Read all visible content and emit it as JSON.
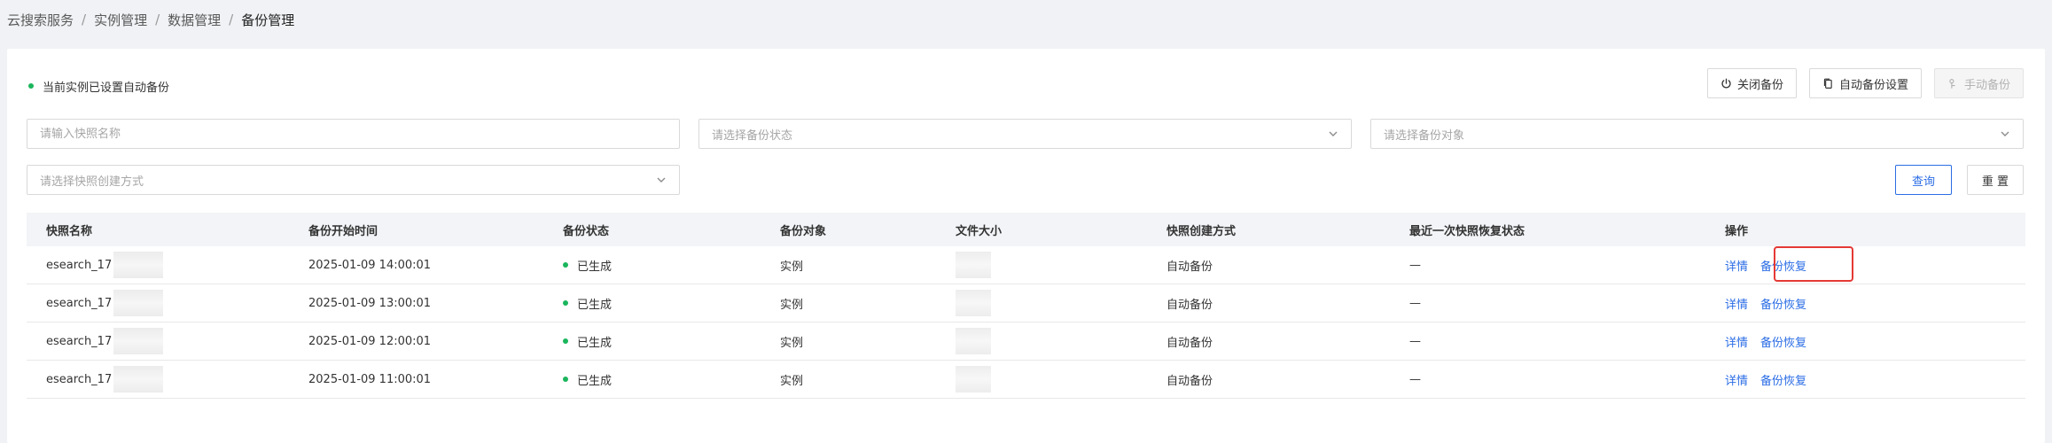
{
  "breadcrumb": [
    "云搜索服务",
    "实例管理",
    "数据管理",
    "备份管理"
  ],
  "status": {
    "text": "当前实例已设置自动备份",
    "color": "#1bb55c"
  },
  "toolbar": {
    "close_backup": "关闭备份",
    "auto_backup_settings": "自动备份设置",
    "manual_backup": "手动备份"
  },
  "filters": {
    "snapshot_name_placeholder": "请输入快照名称",
    "backup_status_placeholder": "请选择备份状态",
    "backup_object_placeholder": "请选择备份对象",
    "creation_method_placeholder": "请选择快照创建方式",
    "query": "查询",
    "reset": "重 置"
  },
  "table": {
    "headers": [
      "快照名称",
      "备份开始时间",
      "备份状态",
      "备份对象",
      "文件大小",
      "快照创建方式",
      "最近一次快照恢复状态",
      "操作"
    ],
    "rows": [
      {
        "name": "esearch_17",
        "start": "2025-01-09 14:00:01",
        "status": "已生成",
        "object": "实例",
        "method": "自动备份",
        "restore_status": "—",
        "detail": "详情",
        "restore": "备份恢复"
      },
      {
        "name": "esearch_17",
        "start": "2025-01-09 13:00:01",
        "status": "已生成",
        "object": "实例",
        "method": "自动备份",
        "restore_status": "—",
        "detail": "详情",
        "restore": "备份恢复"
      },
      {
        "name": "esearch_17",
        "start": "2025-01-09 12:00:01",
        "status": "已生成",
        "object": "实例",
        "method": "自动备份",
        "restore_status": "—",
        "detail": "详情",
        "restore": "备份恢复"
      },
      {
        "name": "esearch_17",
        "start": "2025-01-09 11:00:01",
        "status": "已生成",
        "object": "实例",
        "method": "自动备份",
        "restore_status": "—",
        "detail": "详情",
        "restore": "备份恢复"
      }
    ]
  },
  "colors": {
    "accent": "#2b6de5",
    "success": "#1bb55c",
    "highlight": "#e53935"
  },
  "icons": {
    "close_backup": "power-icon",
    "auto_backup_settings": "copy-icon",
    "manual_backup": "hand-icon",
    "select": "chevron-down-icon"
  }
}
